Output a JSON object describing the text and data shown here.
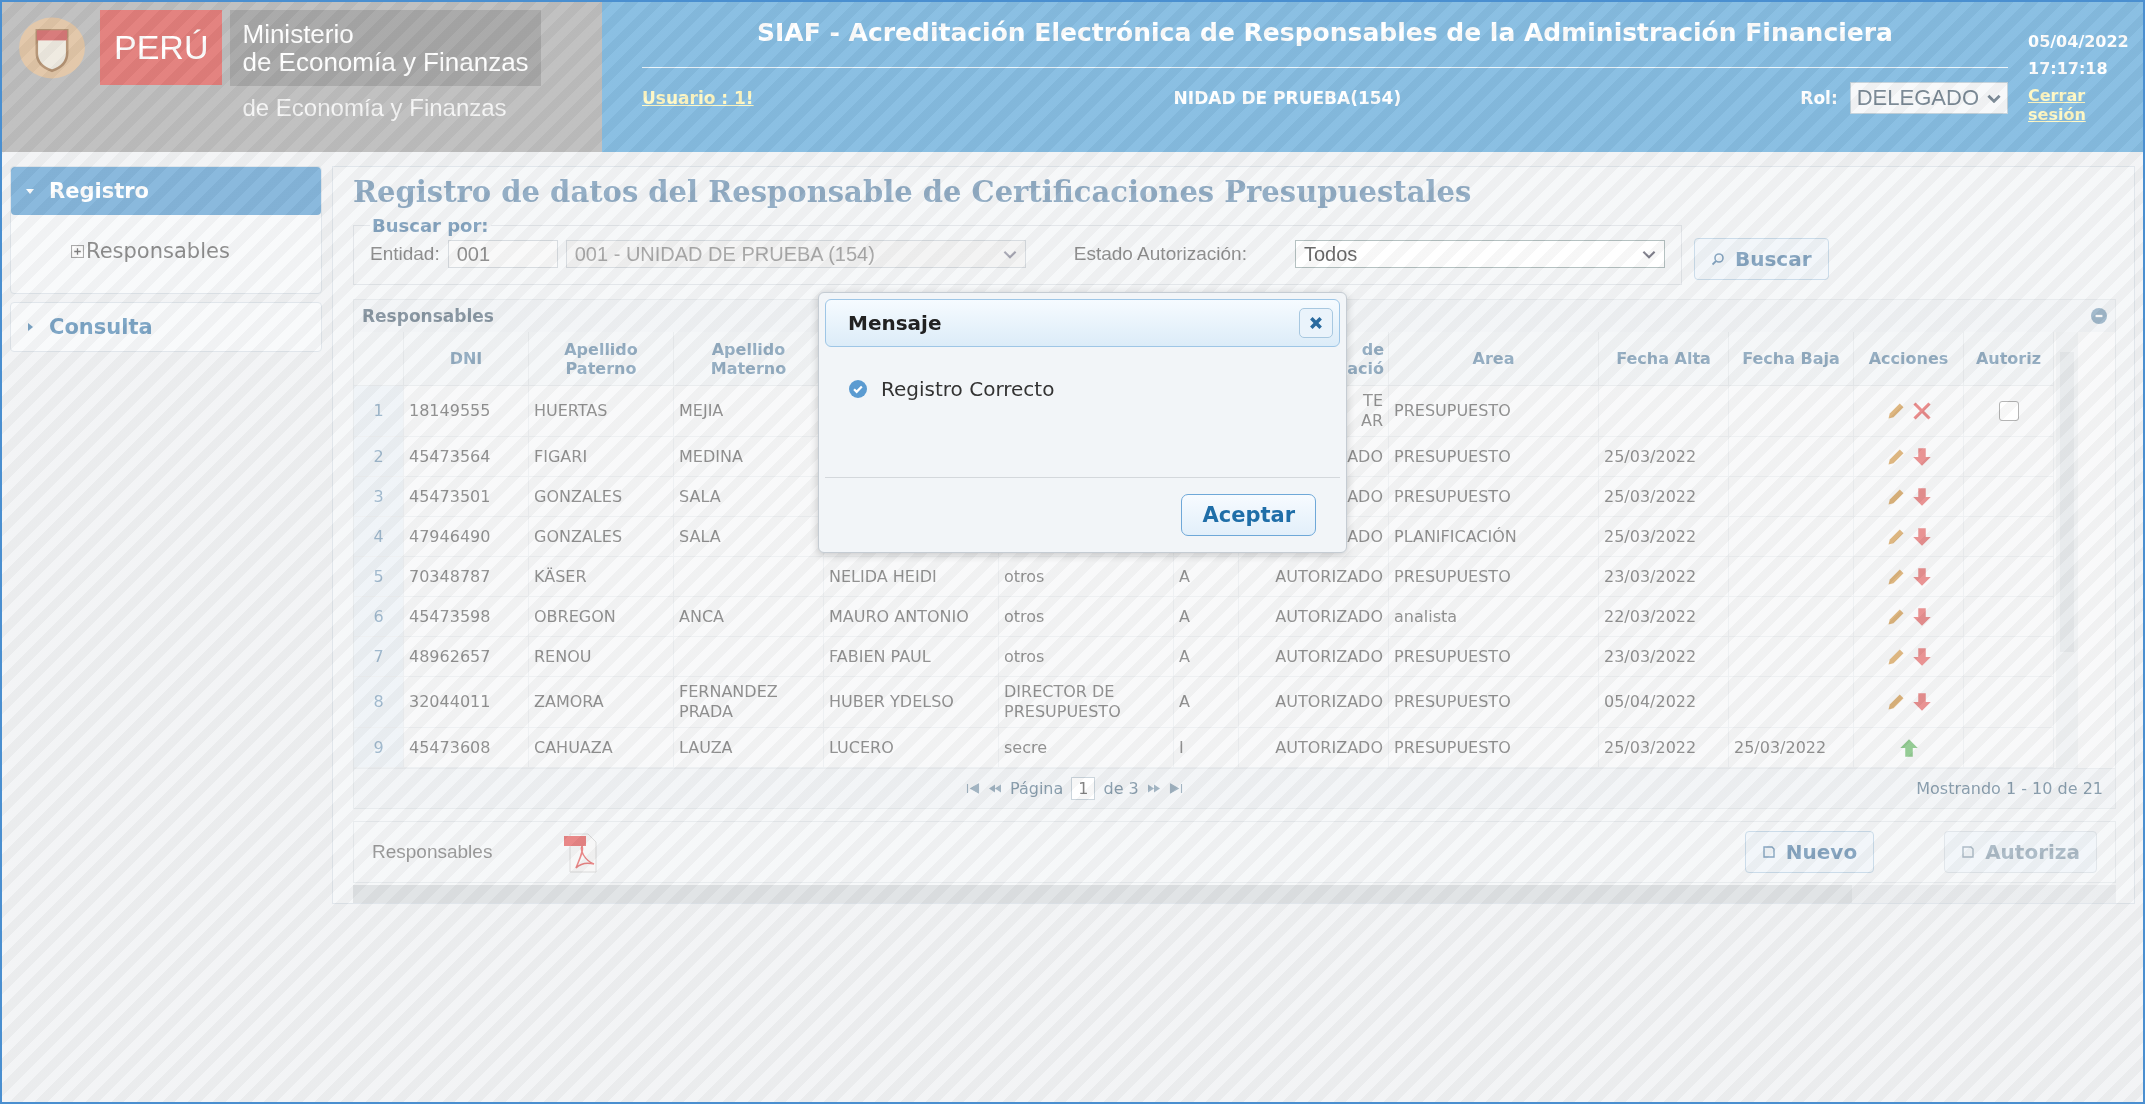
{
  "header": {
    "logo_text": "PERÚ",
    "org_line_1": "Ministerio",
    "org_line_2": "de Economía y Finanzas",
    "org_line_3": "de Economía y Finanzas",
    "title": "SIAF - Acreditación Electrónica de Responsables de la Administración Financiera",
    "user_link": "Usuario : 1!",
    "unit": "NIDAD DE PRUEBA(154)",
    "role_label": "Rol:",
    "role_value": "DELEGADO",
    "date": "05/04/2022",
    "time": "17:17:18",
    "logout": "Cerrar sesión"
  },
  "sidebar": [
    {
      "label": "Registro",
      "expanded": true,
      "selected": true,
      "children": [
        {
          "label": "Responsables",
          "expanded": false
        }
      ]
    },
    {
      "label": "Consulta",
      "expanded": false,
      "selected": false
    }
  ],
  "page_title": "Registro de datos del Responsable de Certificaciones Presupuestales",
  "search": {
    "legend": "Buscar por:",
    "entity_label": "Entidad:",
    "entity_code": "001",
    "entity_name": "001 - UNIDAD DE PRUEBA (154)",
    "status_label": "Estado Autorización:",
    "status_value": "Todos",
    "button": "Buscar"
  },
  "table": {
    "title": "Responsables",
    "columns": [
      "DNI",
      "Apellido Paterno",
      "Apellido Materno",
      null,
      null,
      null,
      "de\nació",
      "Area",
      "Fecha Alta",
      "Fecha Baja",
      "Acciones",
      "Autoriz"
    ],
    "rows": [
      {
        "n": "1",
        "cells": [
          "18149555",
          "HUERTAS",
          "MEJIA",
          null,
          null,
          null,
          "TE\nAR",
          "PRESUPUESTO",
          null,
          null
        ],
        "actions": [
          {
            "kind": "edit"
          },
          {
            "kind": "delete"
          }
        ],
        "authorize": {
          "checked": false
        }
      },
      {
        "n": "2",
        "cells": [
          "45473564",
          "FIGARI",
          "MEDINA",
          null,
          null,
          null,
          "ADO",
          "PRESUPUESTO",
          "25/03/2022",
          null
        ],
        "actions": [
          {
            "kind": "edit"
          },
          {
            "kind": "deactivate"
          }
        ]
      },
      {
        "n": "3",
        "cells": [
          "45473501",
          "GONZALES",
          "SALA",
          null,
          null,
          null,
          "ADO",
          "PRESUPUESTO",
          "25/03/2022",
          null
        ],
        "actions": [
          {
            "kind": "edit"
          },
          {
            "kind": "deactivate"
          }
        ]
      },
      {
        "n": "4",
        "cells": [
          "47946490",
          "GONZALES",
          "SALA",
          null,
          null,
          null,
          "ADO",
          "PLANIFICACIÓN",
          "25/03/2022",
          null
        ],
        "actions": [
          {
            "kind": "edit"
          },
          {
            "kind": "deactivate"
          }
        ]
      },
      {
        "n": "5",
        "cells": [
          "70348787",
          "KÄSER",
          null,
          "NELIDA HEIDI",
          "otros",
          "A",
          "AUTORIZADO",
          "PRESUPUESTO",
          "23/03/2022",
          null
        ],
        "actions": [
          {
            "kind": "edit"
          },
          {
            "kind": "deactivate"
          }
        ]
      },
      {
        "n": "6",
        "cells": [
          "45473598",
          "OBREGON",
          "ANCA",
          "MAURO ANTONIO",
          "otros",
          "A",
          "AUTORIZADO",
          "analista",
          "22/03/2022",
          null
        ],
        "actions": [
          {
            "kind": "edit"
          },
          {
            "kind": "deactivate"
          }
        ]
      },
      {
        "n": "7",
        "cells": [
          "48962657",
          "RENOU",
          null,
          "FABIEN PAUL",
          "otros",
          "A",
          "AUTORIZADO",
          "PRESUPUESTO",
          "23/03/2022",
          null
        ],
        "actions": [
          {
            "kind": "edit"
          },
          {
            "kind": "deactivate"
          }
        ]
      },
      {
        "n": "8",
        "cells": [
          "32044011",
          "ZAMORA",
          "FERNANDEZ PRADA",
          "HUBER YDELSO",
          "DIRECTOR DE PRESUPUESTO",
          "A",
          "AUTORIZADO",
          "PRESUPUESTO",
          "05/04/2022",
          null
        ],
        "actions": [
          {
            "kind": "edit"
          },
          {
            "kind": "deactivate"
          }
        ]
      },
      {
        "n": "9",
        "cells": [
          "45473608",
          "CAHUAZA",
          "LAUZA",
          "LUCERO",
          "secre",
          "I",
          "AUTORIZADO",
          "PRESUPUESTO",
          "25/03/2022",
          "25/03/2022"
        ],
        "actions": [
          {
            "kind": "activate"
          }
        ]
      }
    ],
    "pager": {
      "page_label": "Página",
      "page": "1",
      "of": "de 3",
      "summary": "Mostrando 1 - 10 de 21"
    }
  },
  "footer": {
    "label": "Responsables",
    "new_button": "Nuevo",
    "authorize_button": {
      "label": "Autoriza",
      "disabled": true
    }
  },
  "dialog": {
    "title": "Mensaje",
    "message": "Registro Correcto",
    "button": "Aceptar"
  }
}
